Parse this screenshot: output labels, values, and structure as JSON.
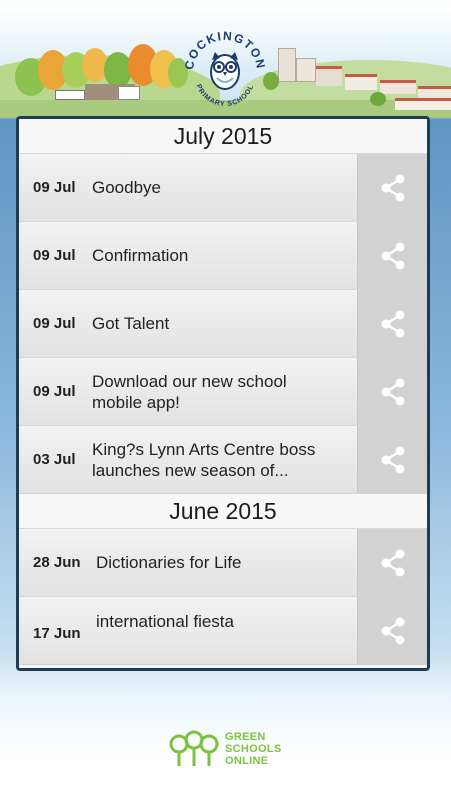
{
  "school": {
    "name_top": "COCKINGTON",
    "name_bottom": "PRIMARY SCHOOL"
  },
  "sections": [
    {
      "header": "July 2015",
      "items": [
        {
          "date": "09 Jul",
          "title": "Goodbye"
        },
        {
          "date": "09 Jul",
          "title": "Confirmation"
        },
        {
          "date": "09 Jul",
          "title": "Got Talent"
        },
        {
          "date": "09 Jul",
          "title": "Download our new school mobile app!"
        },
        {
          "date": "03 Jul",
          "title": "King?s Lynn Arts Centre boss launches new season of..."
        }
      ]
    },
    {
      "header": "June 2015",
      "items": [
        {
          "date": "28 Jun",
          "title": "Dictionaries for Life"
        },
        {
          "date": "17 Jun",
          "title": "international fiesta"
        }
      ]
    }
  ],
  "footer": {
    "line1": "GREEN",
    "line2": "SCHOOLS",
    "line3": "ONLINE"
  },
  "icons": {
    "share": "share-icon",
    "logo": "owl-logo-icon",
    "footer": "green-schools-logo-icon"
  },
  "colors": {
    "panel_border": "#1e3d55",
    "share_icon": "#ffffff",
    "footer_green": "#7cc242"
  }
}
